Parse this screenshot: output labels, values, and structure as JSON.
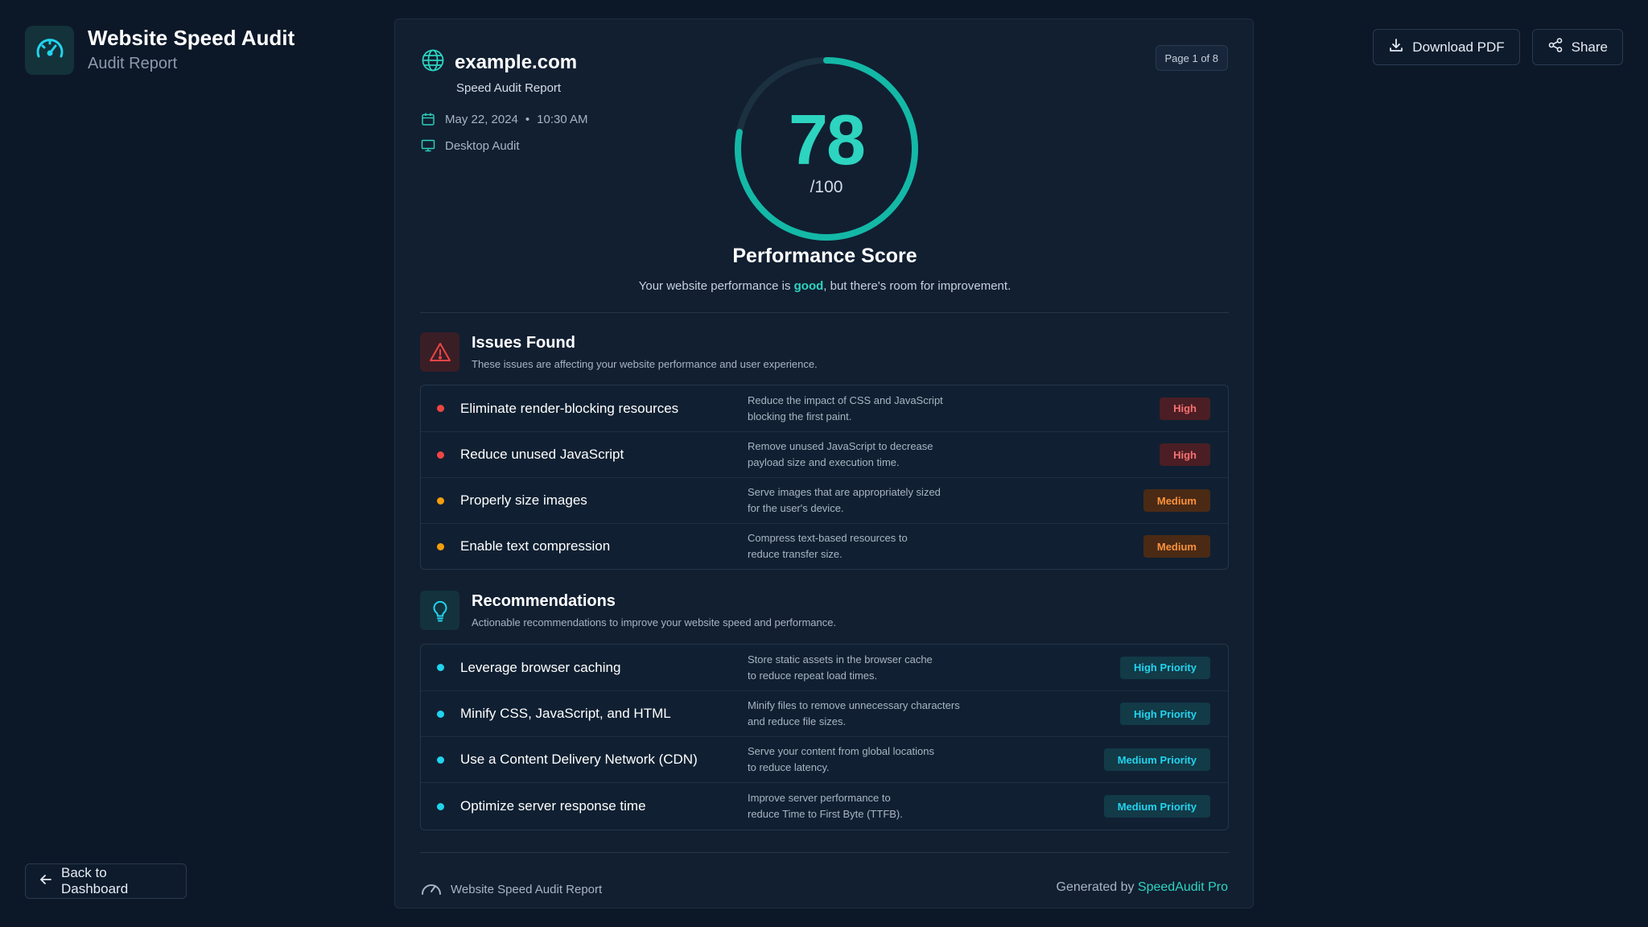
{
  "app": {
    "title": "Website Speed Audit",
    "subtitle": "Audit Report",
    "icon": "speedometer-icon"
  },
  "actions": {
    "download_label": "Download PDF",
    "share_label": "Share",
    "back_label": "Back to Dashboard"
  },
  "report": {
    "site": "example.com",
    "subtitle": "Speed Audit Report",
    "date": "May 22, 2024",
    "time": "10:30 AM",
    "separator": "•",
    "device": "Desktop Audit",
    "page": "Page 1 of 8"
  },
  "score": {
    "value": "78",
    "max": "/100",
    "fraction": 0.78,
    "title": "Performance Score",
    "desc_before": "Your website performance is ",
    "desc_highlight": "good",
    "desc_after": ", but there's room for improvement."
  },
  "issues": {
    "title": "Issues Found",
    "subtitle": "These issues are affecting your website performance and user experience.",
    "items": [
      {
        "title": "Eliminate render-blocking resources",
        "desc1": "Reduce the impact of CSS and JavaScript",
        "desc2": "blocking the first paint.",
        "tag": "High"
      },
      {
        "title": "Reduce unused JavaScript",
        "desc1": "Remove unused JavaScript to decrease",
        "desc2": "payload size and execution time.",
        "tag": "High"
      },
      {
        "title": "Properly size images",
        "desc1": "Serve images that are appropriately sized",
        "desc2": "for the user's device.",
        "tag": "Medium"
      },
      {
        "title": "Enable text compression",
        "desc1": "Compress text-based resources to",
        "desc2": "reduce transfer size.",
        "tag": "Medium"
      }
    ]
  },
  "recommendations": {
    "title": "Recommendations",
    "subtitle": "Actionable recommendations to improve your website speed and performance.",
    "items": [
      {
        "title": "Leverage browser caching",
        "desc1": "Store static assets in the browser cache",
        "desc2": "to reduce repeat load times.",
        "tag": "High Priority"
      },
      {
        "title": "Minify CSS, JavaScript, and HTML",
        "desc1": "Minify files to remove unnecessary characters",
        "desc2": "and reduce file sizes.",
        "tag": "High Priority"
      },
      {
        "title": "Use a Content Delivery Network (CDN)",
        "desc1": "Serve your content from global locations",
        "desc2": "to reduce latency.",
        "tag": "Medium Priority"
      },
      {
        "title": "Optimize server response time",
        "desc1": "Improve server performance to",
        "desc2": "reduce Time to First Byte (TTFB).",
        "tag": "Medium Priority"
      }
    ]
  },
  "footer": {
    "left": "Website Speed Audit Report",
    "right_prefix": "Generated by ",
    "right_brand": "SpeedAudit Pro"
  },
  "colors": {
    "accent": "#2dd4bf",
    "high": "#f87171",
    "medium": "#fb923c",
    "priority": "#22d3ee",
    "background": "#0c1828",
    "card": "#111f31"
  }
}
